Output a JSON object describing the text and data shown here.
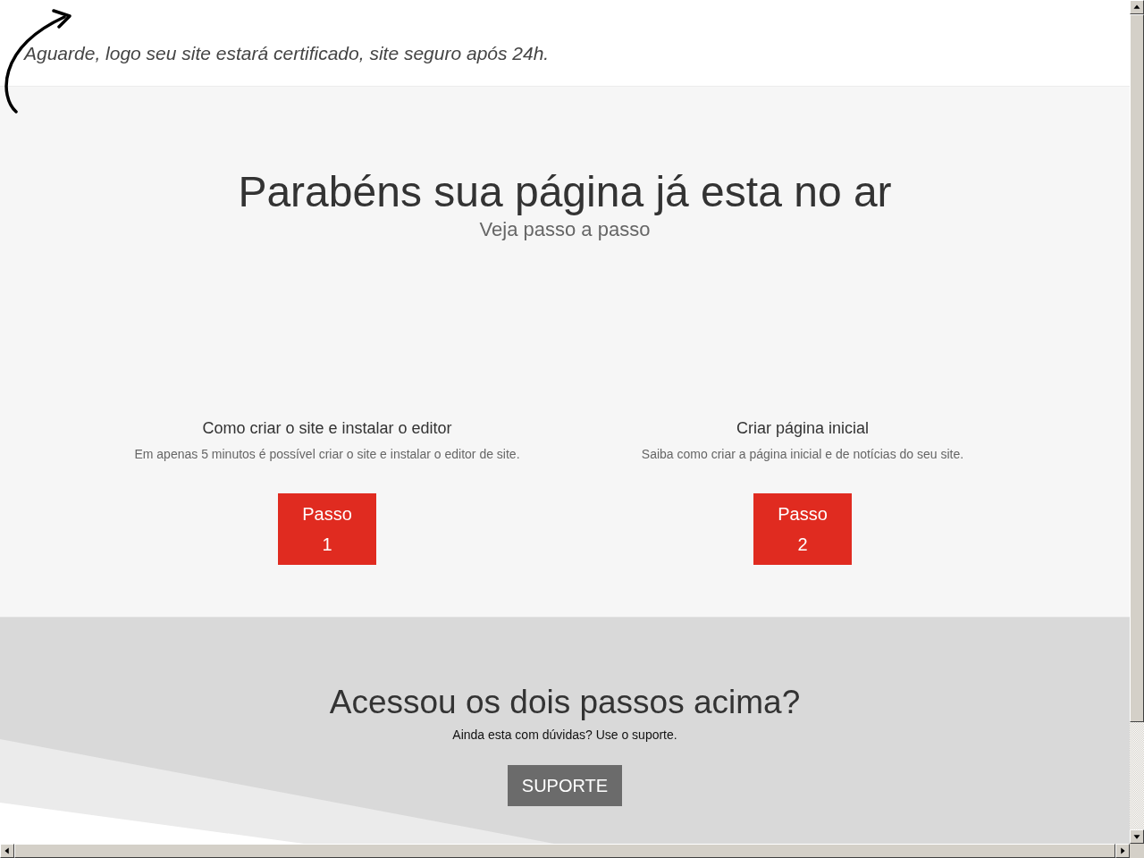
{
  "notice": {
    "text": "Aguarde, logo seu site estará certificado, site seguro após 24h."
  },
  "hero": {
    "title": "Parabéns sua página já esta no ar",
    "subtitle": "Veja passo a passo"
  },
  "steps": [
    {
      "title": "Como criar o site e instalar o editor",
      "description": "Em apenas 5 minutos é possível criar o site e instalar o editor de site.",
      "button": "Passo 1"
    },
    {
      "title": "Criar página inicial",
      "description": "Saiba como criar a página inicial e de notícias do seu site.",
      "button": "Passo 2"
    }
  ],
  "support": {
    "title": "Acessou os dois passos acima?",
    "text": "Ainda esta com dúvidas? Use o suporte.",
    "button": "SUPORTE"
  }
}
